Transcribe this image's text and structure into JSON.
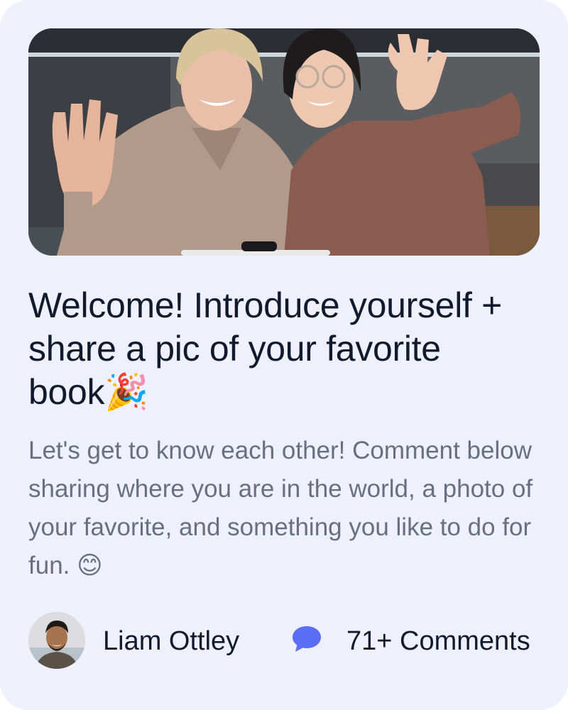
{
  "post": {
    "image_alt": "Two smiling women waving at the camera in a kitchen",
    "title": "Welcome! Introduce yourself + share a pic of your favorite book🎉",
    "description": "Let's get to know each other! Comment below sharing where you are in the world, a photo of your favorite, and something you like to do for fun. 😊",
    "author": "Liam Ottley",
    "comments_label": "71+ Comments",
    "comment_icon": "chat-bubble-icon"
  },
  "colors": {
    "card_background": "#eef0fc",
    "title_text": "#121a2c",
    "body_text": "#6a6f80",
    "accent": "#5b6ef5"
  }
}
